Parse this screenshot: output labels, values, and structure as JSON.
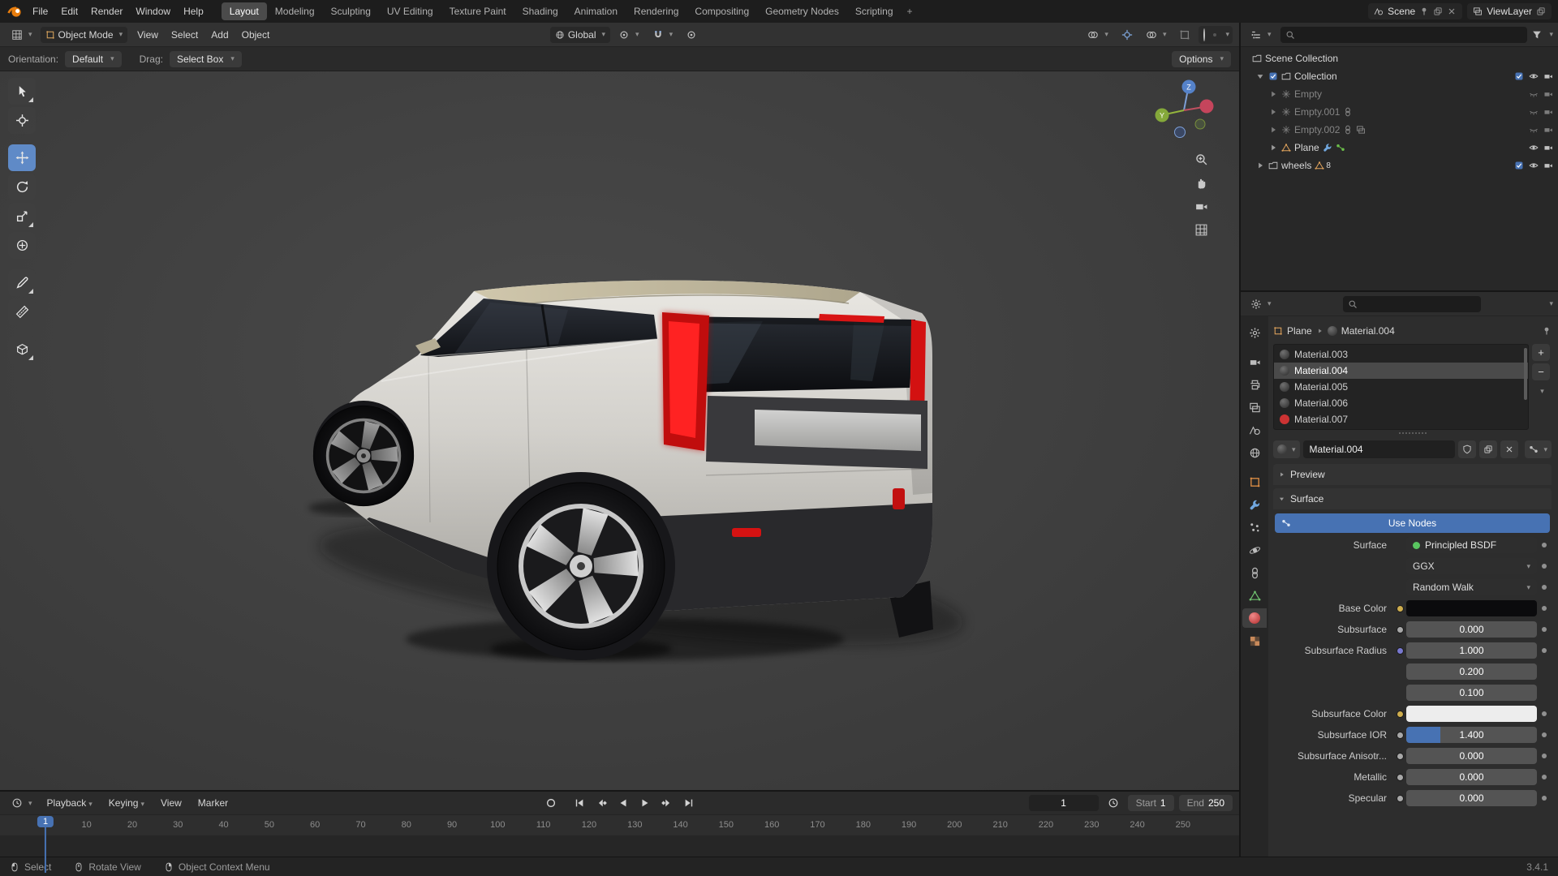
{
  "topbar": {
    "menus": [
      "File",
      "Edit",
      "Render",
      "Window",
      "Help"
    ],
    "workspaces": [
      "Layout",
      "Modeling",
      "Sculpting",
      "UV Editing",
      "Texture Paint",
      "Shading",
      "Animation",
      "Rendering",
      "Compositing",
      "Geometry Nodes",
      "Scripting"
    ],
    "active_workspace": "Layout",
    "workspace_add": "+",
    "scene_name": "Scene",
    "viewlayer_name": "ViewLayer"
  },
  "viewport_header": {
    "mode": "Object Mode",
    "menus": [
      "View",
      "Select",
      "Add",
      "Object"
    ],
    "orientation": "Global"
  },
  "tool_settings": {
    "orientation_label": "Orientation:",
    "orientation_value": "Default",
    "drag_label": "Drag:",
    "drag_value": "Select Box",
    "options_label": "Options"
  },
  "gizmo": {
    "z_label": "Z",
    "y_label": "Y"
  },
  "outliner": {
    "scene_collection": "Scene Collection",
    "collection": "Collection",
    "empty1": "Empty",
    "empty2": "Empty.001",
    "empty3": "Empty.002",
    "plane": "Plane",
    "wheels": "wheels",
    "wheels_count": "8"
  },
  "properties": {
    "breadcrumb_object": "Plane",
    "breadcrumb_material": "Material.004",
    "slots": [
      {
        "name": "Material.003"
      },
      {
        "name": "Material.004"
      },
      {
        "name": "Material.005"
      },
      {
        "name": "Material.006"
      },
      {
        "name": "Material.007"
      }
    ],
    "slot_add": "+",
    "slot_remove": "−",
    "datablock_name": "Material.004",
    "preview_label": "Preview",
    "surface_label": "Surface",
    "use_nodes_label": "Use Nodes",
    "surface_row_label": "Surface",
    "surface_row_value": "Principled BSDF",
    "distribution_value": "GGX",
    "sss_method_value": "Random Walk",
    "fields": [
      {
        "label": "Base Color",
        "type": "color",
        "socket": "#cfae4e",
        "swatch": "#0b0b0d"
      },
      {
        "label": "Subsurface",
        "type": "slider",
        "socket": "#a8a8a8",
        "value": "0.000"
      },
      {
        "label": "Subsurface Radius",
        "type": "slider",
        "socket": "#7878d0",
        "value": "1.000"
      },
      {
        "label": "",
        "type": "slider",
        "socket": "",
        "value": "0.200"
      },
      {
        "label": "",
        "type": "slider",
        "socket": "",
        "value": "0.100"
      },
      {
        "label": "Subsurface Color",
        "type": "color",
        "socket": "#cfae4e",
        "swatch": "#ededed"
      },
      {
        "label": "Subsurface IOR",
        "type": "slider",
        "socket": "#a8a8a8",
        "value": "1.400",
        "fill": "26%"
      },
      {
        "label": "Subsurface Anisotr...",
        "type": "slider",
        "socket": "#a8a8a8",
        "value": "0.000"
      },
      {
        "label": "Metallic",
        "type": "slider",
        "socket": "#a8a8a8",
        "value": "0.000"
      },
      {
        "label": "Specular",
        "type": "slider",
        "socket": "#a8a8a8",
        "value": "0.000"
      }
    ],
    "accent_color": "#4772b3",
    "material_red": "#cc3333",
    "shader_socket_color": "#59c560"
  },
  "timeline": {
    "menus": [
      "Playback",
      "Keying",
      "View",
      "Marker"
    ],
    "current_frame": "1",
    "start_label": "Start",
    "start_value": "1",
    "end_label": "End",
    "end_value": "250",
    "playhead": "1",
    "ruler": [
      "10",
      "20",
      "30",
      "40",
      "50",
      "60",
      "70",
      "80",
      "90",
      "100",
      "110",
      "120",
      "130",
      "140",
      "150",
      "160",
      "170",
      "180",
      "190",
      "200",
      "210",
      "220",
      "230",
      "240",
      "250"
    ]
  },
  "statusbar": {
    "select": "Select",
    "rotate_view": "Rotate View",
    "context_menu": "Object Context Menu",
    "version": "3.4.1"
  },
  "icons": {
    "search": "magnifier",
    "filter": "funnel",
    "hide_toggle": "eye",
    "render_toggle": "camera",
    "snap": "magnet",
    "orientation": "globe",
    "timeline_editor": "clock",
    "left_click": "mouse-left-button",
    "middle_click": "mouse-middle-button",
    "right_click": "mouse-right-button"
  }
}
